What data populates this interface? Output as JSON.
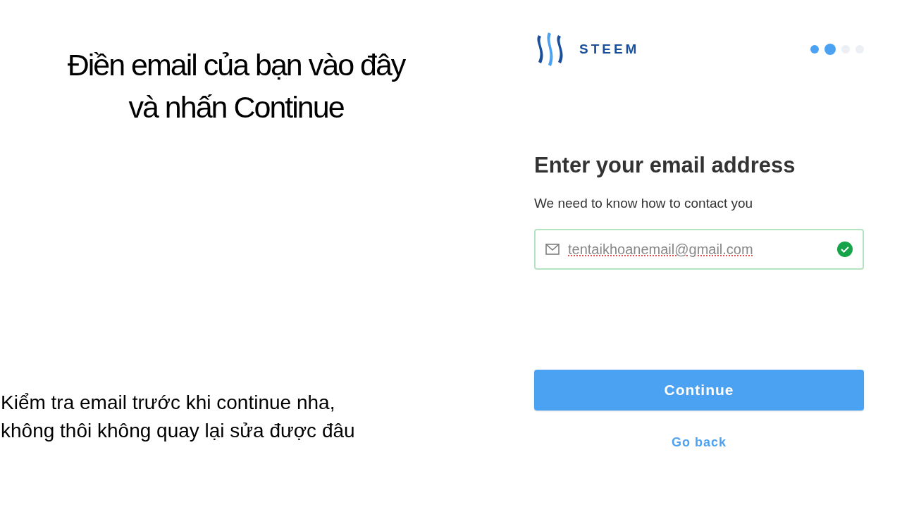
{
  "annotation_title": [
    "Điền email của bạn vào đây",
    "và nhấn Continue"
  ],
  "annotation_note": [
    "Kiểm tra email trước khi continue nha,",
    "không thôi không quay lại sửa được đâu"
  ],
  "logo": {
    "text": "STEEM"
  },
  "steps": [
    {
      "filled": true,
      "selected": false
    },
    {
      "filled": true,
      "selected": true
    },
    {
      "filled": false,
      "selected": false
    },
    {
      "filled": false,
      "selected": false
    }
  ],
  "heading": "Enter your email address",
  "subtitle": "We need to know how to contact you",
  "email_field": {
    "value": "tentaikhoanemail@gmail.com",
    "valid": true
  },
  "continue_button": "Continue",
  "back_link": "Go back"
}
